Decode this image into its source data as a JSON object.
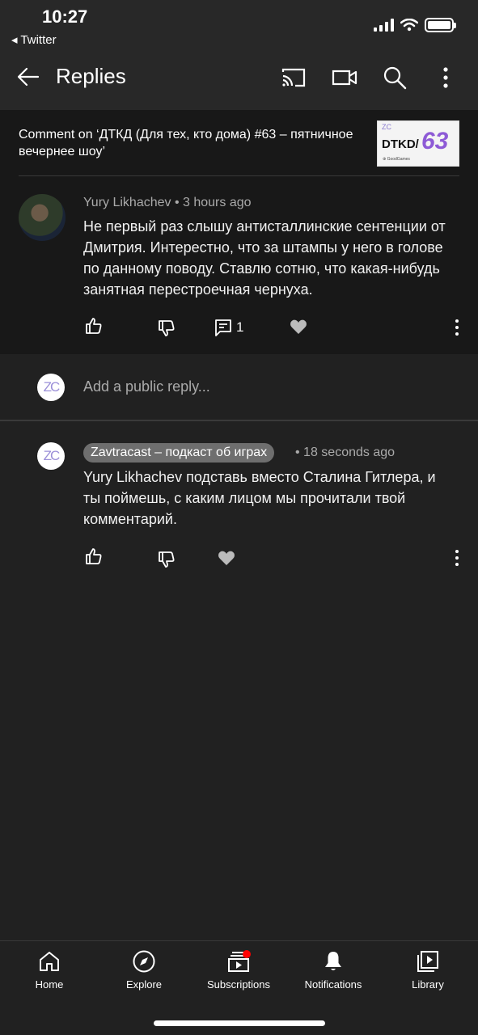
{
  "status_bar": {
    "time": "10:27",
    "back_app": "◂ Twitter"
  },
  "header": {
    "title": "Replies"
  },
  "context": {
    "comment_on": "Comment on ‘ДТКД (Для тех, кто дома) #63 – пятничное вечернее шоу’",
    "thumbnail": {
      "logo": "ZC",
      "label": "DTKD/",
      "number": "63",
      "small": "⊕ GoodGames"
    }
  },
  "comment": {
    "author": "Yury Likhachev",
    "time": "• 3 hours ago",
    "text": "Не первый раз слышу антисталлинские сентенции от Дмитрия. Интерестно, что за штампы у него в голове по данному поводу. Ставлю сотню, что какая-нибудь занятная перестроечная чернуха.",
    "reply_count": "1"
  },
  "reply_input": {
    "placeholder": "Add a public reply...",
    "avatar_text": "ZC"
  },
  "reply": {
    "author": "Zavtracast – подкаст об играх",
    "time": "• 18 seconds ago",
    "text": "Yury Likhachev подставь вместо Сталина Гитлера, и ты поймешь, с каким лицом мы прочитали твой комментарий.",
    "avatar_text": "ZC"
  },
  "bottom_nav": [
    {
      "label": "Home",
      "icon": "home-icon"
    },
    {
      "label": "Explore",
      "icon": "compass-icon"
    },
    {
      "label": "Subscriptions",
      "icon": "subscriptions-icon"
    },
    {
      "label": "Notifications",
      "icon": "bell-icon"
    },
    {
      "label": "Library",
      "icon": "library-icon"
    }
  ],
  "colors": {
    "notification_dot": "#ff0000",
    "creator_chip": "#6e6e6e",
    "zc_logo": "#9b8fd8"
  }
}
